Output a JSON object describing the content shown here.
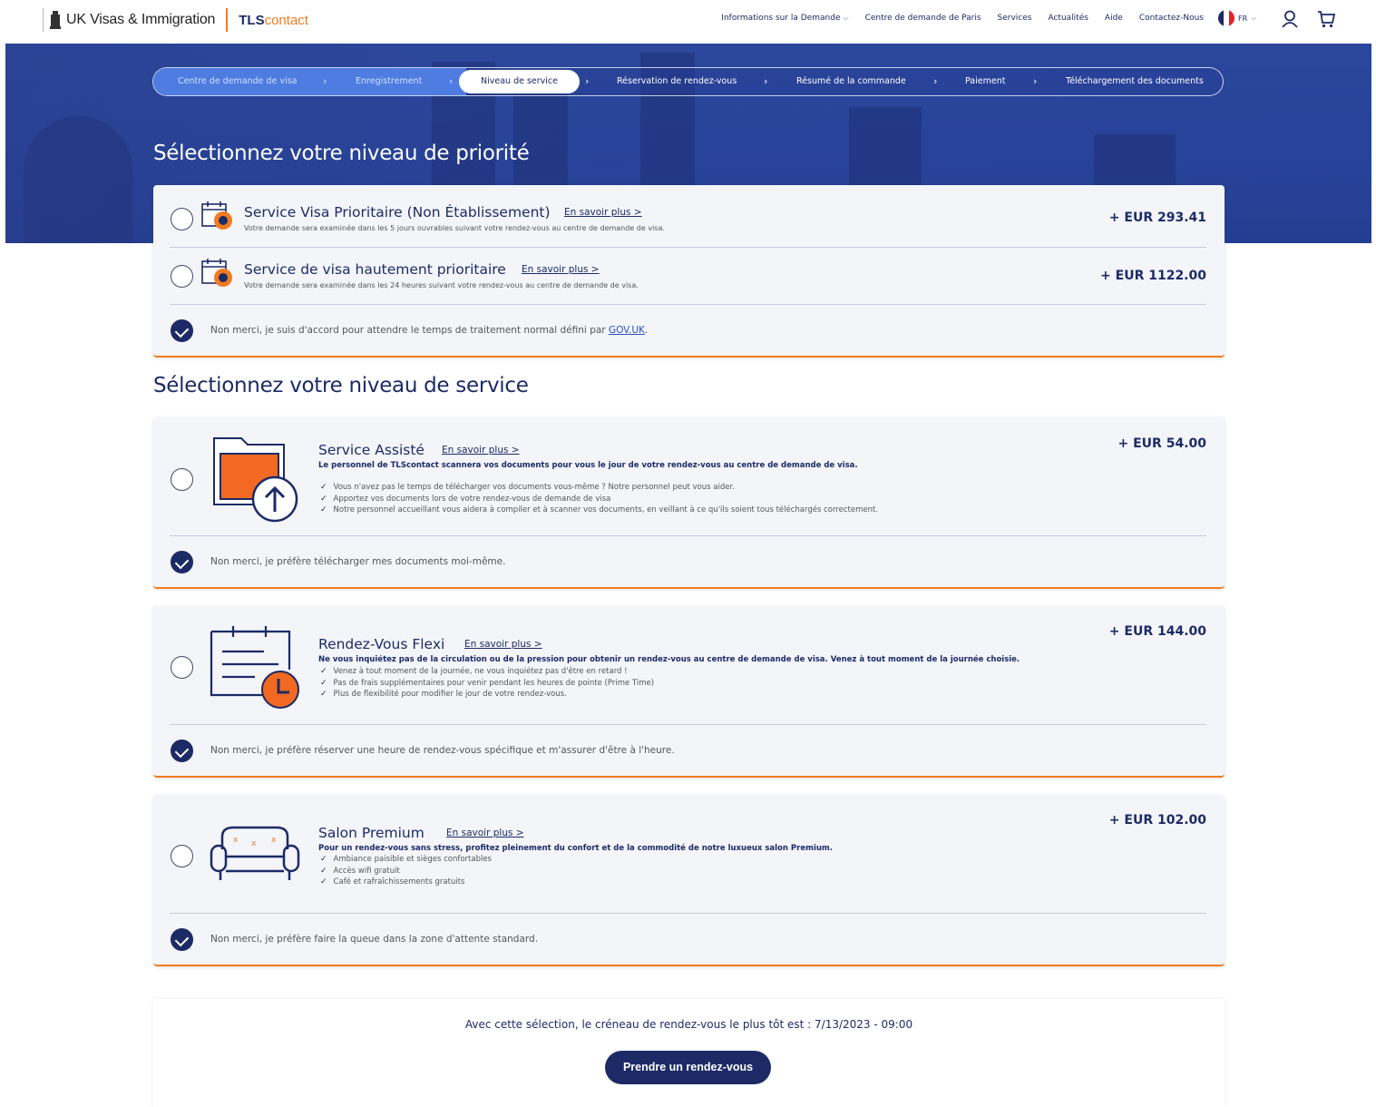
{
  "header": {
    "brand_uk": "UK Visas & Immigration",
    "brand_tls": "TLS",
    "brand_contact": "contact",
    "nav": [
      {
        "label": "Informations sur la Demande",
        "has_dropdown": true
      },
      {
        "label": "Centre de demande de Paris",
        "has_dropdown": false
      },
      {
        "label": "Services",
        "has_dropdown": false
      },
      {
        "label": "Actualités",
        "has_dropdown": false
      },
      {
        "label": "Aide",
        "has_dropdown": false
      },
      {
        "label": "Contactez-Nous",
        "has_dropdown": false
      }
    ],
    "language": "FR",
    "icons": [
      "user-icon",
      "cart-icon"
    ]
  },
  "stepper": {
    "steps": [
      {
        "label": "Centre de demande de visa",
        "state": "done"
      },
      {
        "label": "Enregistrement",
        "state": "done"
      },
      {
        "label": "Niveau de service",
        "state": "active"
      },
      {
        "label": "Réservation de rendez-vous",
        "state": "todo"
      },
      {
        "label": "Résumé de la commande",
        "state": "todo"
      },
      {
        "label": "Paiement",
        "state": "todo"
      },
      {
        "label": "Téléchargement des documents",
        "state": "todo"
      }
    ]
  },
  "priority": {
    "heading": "Sélectionnez votre niveau de priorité",
    "options": [
      {
        "title": "Service Visa Prioritaire (Non Établissement)",
        "more": "En savoir plus >",
        "desc": "Votre demande sera examinée dans les 5 jours ouvrables suivant votre rendez-vous au centre de demande de visa.",
        "price": "+ EUR 293.41",
        "selected": false
      },
      {
        "title": "Service de visa hautement prioritaire",
        "more": "En savoir plus >",
        "desc": "Votre demande sera examinée dans les 24 heures suivant votre rendez-vous au centre de demande de visa.",
        "price": "+ EUR 1122.00",
        "selected": false
      }
    ],
    "decline": "Non merci, je suis d'accord pour attendre le temps de traitement normal défini par",
    "decline_link": "GOV.UK",
    "decline_end": ".",
    "decline_selected": true
  },
  "service": {
    "heading": "Sélectionnez votre niveau de service",
    "cards": [
      {
        "title": "Service Assisté",
        "more": "En savoir plus >",
        "bold": "Le personnel de TLScontact scannera vos documents pour vous le jour de votre rendez-vous au centre de demande de visa.",
        "bullets": [
          "Vous n'avez pas le temps de télécharger vos documents vous-même ? Notre personnel peut vous aider.",
          "Apportez vos documents lors de votre rendez-vous de demande de visa",
          "Notre personnel accueillant vous aidera à compiler et à scanner vos documents, en veillant à ce qu'ils soient tous téléchargés correctement."
        ],
        "price": "+ EUR 54.00",
        "icon": "folder-upload-icon",
        "decline": "Non merci, je préfère télécharger mes documents moi-même.",
        "selected": false
      },
      {
        "title": "Rendez-Vous Flexi",
        "more": "En savoir plus >",
        "bold": "Ne vous inquiétez pas de la circulation ou de la pression pour obtenir un rendez-vous au centre de demande de visa. Venez à tout moment de la journée choisie.",
        "bullets": [
          "Venez à tout moment de la journée, ne vous inquiétez pas d'être en retard !",
          "Pas de frais supplémentaires pour venir pendant les heures de pointe (Prime Time)",
          "Plus de flexibilité pour modifier le jour de votre rendez-vous."
        ],
        "price": "+ EUR 144.00",
        "icon": "calendar-clock-icon",
        "decline": "Non merci, je préfère réserver une heure de rendez-vous spécifique et m'assurer d'être à l'heure.",
        "selected": false
      },
      {
        "title": "Salon Premium",
        "more": "En savoir plus >",
        "bold": "Pour un rendez-vous sans stress, profitez pleinement du confort et de la commodité de notre luxueux salon Premium.",
        "bullets": [
          "Ambiance paisible et sièges confortables",
          "Accès wifi gratuit",
          "Café et rafraîchissements gratuits"
        ],
        "price": "+ EUR 102.00",
        "icon": "sofa-icon",
        "decline": "Non merci, je préfère faire la queue dans la zone d'attente standard.",
        "selected": false
      }
    ]
  },
  "footer": {
    "earliest": "Avec cette sélection, le créneau de rendez-vous le plus tôt est : 7/13/2023 - 09:00",
    "cta": "Prendre un rendez-vous"
  },
  "colors": {
    "navy": "#1c2b66",
    "orange": "#f27b21",
    "hero_blue": "#2f4d9e",
    "step_done": "#4f7ce0"
  }
}
